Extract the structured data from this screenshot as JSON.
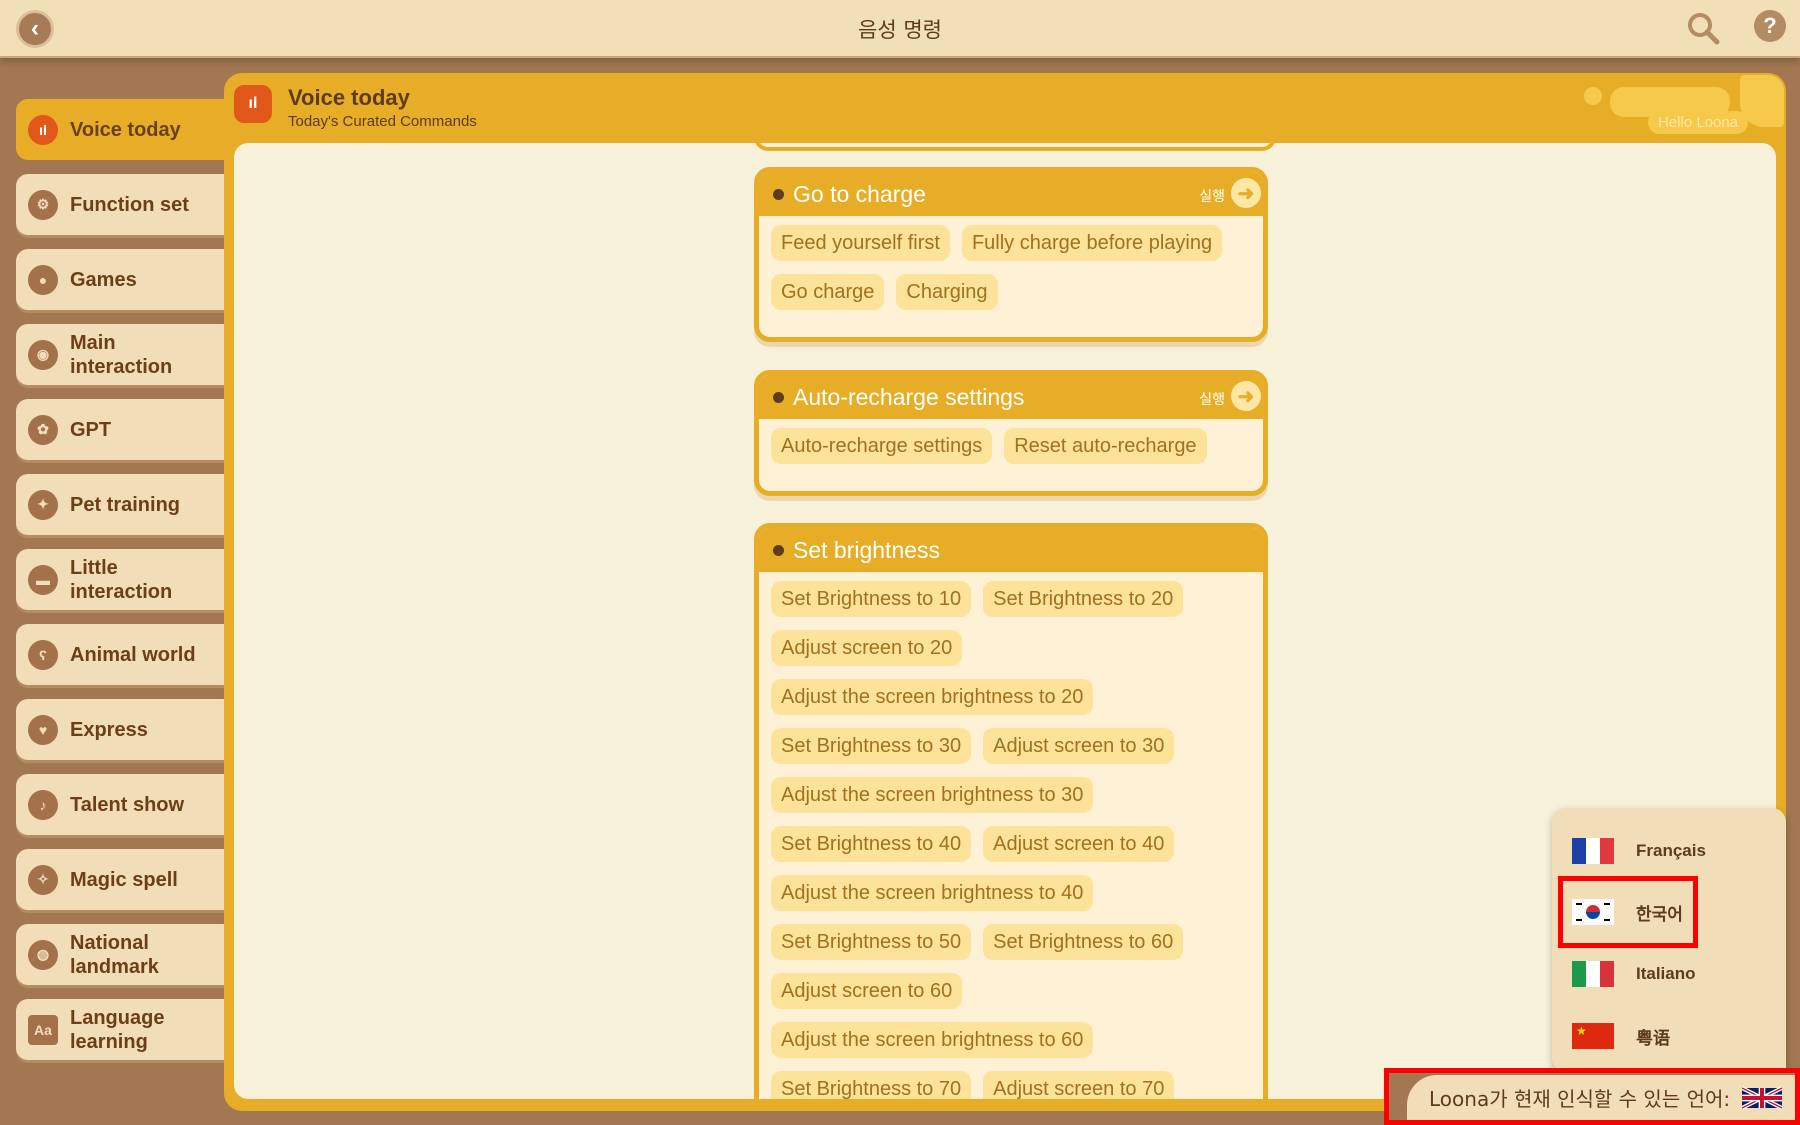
{
  "header": {
    "title": "음성 명령",
    "back_icon": "back-arrow-icon",
    "search_icon": "search-icon",
    "help_icon": "help-icon"
  },
  "sidebar": {
    "items": [
      {
        "label": "Voice today",
        "icon": "voice-today-icon",
        "active": true
      },
      {
        "label": "Function set",
        "icon": "gears-icon"
      },
      {
        "label": "Games",
        "icon": "gamepad-icon"
      },
      {
        "label": "Main interaction",
        "icon": "robot-face-icon"
      },
      {
        "label": "GPT",
        "icon": "gpt-icon"
      },
      {
        "label": "Pet training",
        "icon": "pet-training-icon"
      },
      {
        "label": "Little interaction",
        "icon": "hat-icon"
      },
      {
        "label": "Animal world",
        "icon": "bear-icon"
      },
      {
        "label": "Express",
        "icon": "heart-icon"
      },
      {
        "label": "Talent show",
        "icon": "music-note-icon"
      },
      {
        "label": "Magic spell",
        "icon": "magic-wand-icon"
      },
      {
        "label": "National landmark",
        "icon": "globe-icon"
      },
      {
        "label": "Language learning",
        "icon": "abc-book-icon"
      }
    ]
  },
  "panel": {
    "title": "Voice today",
    "subtitle": "Today's Curated Commands",
    "hello_tag": "Hello Loona"
  },
  "cards": [
    {
      "title": "Go to charge",
      "run_label": "실행",
      "rows": [
        [
          "Feed yourself first",
          "Fully charge before playing"
        ],
        [
          "Go charge",
          "Charging"
        ]
      ]
    },
    {
      "title": "Auto-recharge settings",
      "run_label": "실행",
      "rows": [
        [
          "Auto-recharge settings",
          "Reset auto-recharge"
        ]
      ]
    },
    {
      "title": "Set brightness",
      "run_label": "",
      "rows": [
        [
          "Set Brightness to 10",
          "Set Brightness to 20"
        ],
        [
          "Adjust screen to 20"
        ],
        [
          "Adjust the screen brightness to 20"
        ],
        [
          "Set Brightness to 30",
          "Adjust screen to 30"
        ],
        [
          "Adjust the screen brightness to 30"
        ],
        [
          "Set Brightness to 40",
          "Adjust screen to 40"
        ],
        [
          "Adjust the screen brightness to 40"
        ],
        [
          "Set Brightness to 50",
          "Set Brightness to 60"
        ],
        [
          "Adjust screen to 60"
        ],
        [
          "Adjust the screen brightness to 60"
        ],
        [
          "Set Brightness to 70",
          "Adjust screen to 70"
        ]
      ]
    }
  ],
  "language_popup": {
    "options": [
      {
        "label": "Français",
        "flag": "france-flag-icon"
      },
      {
        "label": "한국어",
        "flag": "korea-flag-icon",
        "selected": true
      },
      {
        "label": "Italiano",
        "flag": "italy-flag-icon"
      },
      {
        "label": "粤语",
        "flag": "china-flag-icon"
      }
    ]
  },
  "language_bar": {
    "text": "Loona가 현재 인식할 수 있는 언어:",
    "flag": "uk-flag-icon"
  }
}
